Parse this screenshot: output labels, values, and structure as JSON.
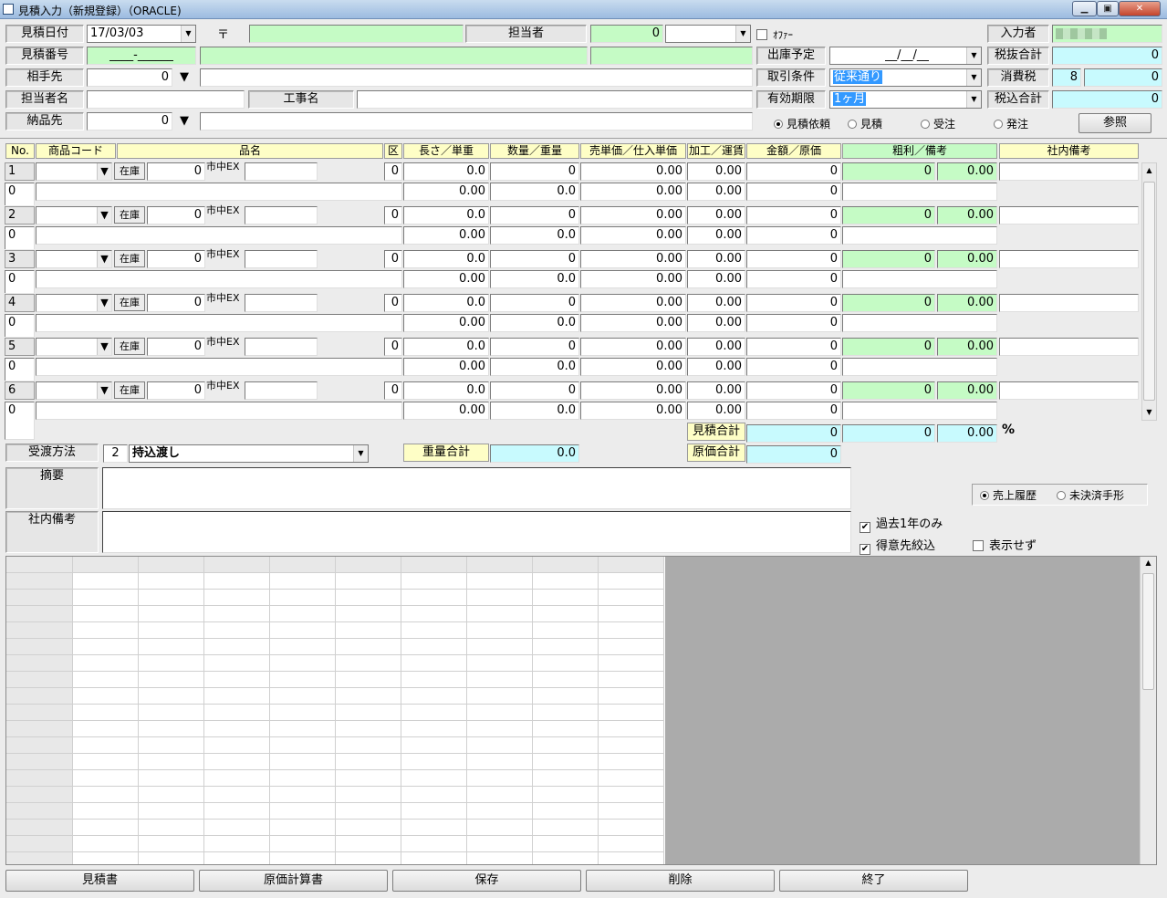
{
  "window": {
    "title": "見積入力（新規登録）（ORACLE)",
    "min": "▁",
    "max": "▣",
    "close": "✕"
  },
  "header": {
    "date_label": "見積日付",
    "date_value": "17/03/03",
    "postal_mark": "〒",
    "postal_value": "",
    "tanto_label": "担当者",
    "tanto_code": "0",
    "tanto_name": "",
    "offer_label": "ｵﾌｧｰ",
    "nyuryoku_label": "入力者",
    "mitsumori_no_label": "見積番号",
    "mitsumori_no_value": "____-______",
    "aite_label": "相手先",
    "aite_code": "0",
    "tantoname_label": "担当者名",
    "koji_label": "工事名",
    "nohin_label": "納品先",
    "nohin_code": "0",
    "shukko_label": "出庫予定",
    "shukko_value": "__/__/__",
    "torihiki_label": "取引条件",
    "torihiki_value": "従来通り",
    "yuko_label": "有効期限",
    "yuko_value": "1ヶ月",
    "zeinuki_label": "税抜合計",
    "zeinuki_value": "0",
    "shohizei_label": "消費税",
    "shohizei_rate": "8",
    "shohizei_value": "0",
    "zeikomi_label": "税込合計",
    "zeikomi_value": "0",
    "type_radios": [
      {
        "label": "見積依頼",
        "checked": true
      },
      {
        "label": "見積",
        "checked": false
      },
      {
        "label": "受注",
        "checked": false
      },
      {
        "label": "発注",
        "checked": false
      }
    ],
    "sansho_button": "参照"
  },
  "columns": {
    "no": "No.",
    "code": "商品コード",
    "name": "品名",
    "ku": "区",
    "length": "長さ／単重",
    "qty": "数量／重量",
    "price": "売単価／仕入単価",
    "kako": "加工／運賃",
    "amount": "金額／原価",
    "arari": "粗利／備考",
    "bikou": "社内備考"
  },
  "rows": [
    {
      "no": "1",
      "sub": "0",
      "qty": "0",
      "ku": "0",
      "len": "0.0",
      "num": "0",
      "price": "0.00",
      "kako": "0.00",
      "amount": "0",
      "arari": "0",
      "rate": "0.00",
      "wt": "0.00",
      "wq": "0.0",
      "cost": "0.00",
      "freight": "0.00",
      "genka": "0"
    },
    {
      "no": "2",
      "sub": "0",
      "qty": "0",
      "ku": "0",
      "len": "0.0",
      "num": "0",
      "price": "0.00",
      "kako": "0.00",
      "amount": "0",
      "arari": "0",
      "rate": "0.00",
      "wt": "0.00",
      "wq": "0.0",
      "cost": "0.00",
      "freight": "0.00",
      "genka": "0"
    },
    {
      "no": "3",
      "sub": "0",
      "qty": "0",
      "ku": "0",
      "len": "0.0",
      "num": "0",
      "price": "0.00",
      "kako": "0.00",
      "amount": "0",
      "arari": "0",
      "rate": "0.00",
      "wt": "0.00",
      "wq": "0.0",
      "cost": "0.00",
      "freight": "0.00",
      "genka": "0"
    },
    {
      "no": "4",
      "sub": "0",
      "qty": "0",
      "ku": "0",
      "len": "0.0",
      "num": "0",
      "price": "0.00",
      "kako": "0.00",
      "amount": "0",
      "arari": "0",
      "rate": "0.00",
      "wt": "0.00",
      "wq": "0.0",
      "cost": "0.00",
      "freight": "0.00",
      "genka": "0"
    },
    {
      "no": "5",
      "sub": "0",
      "qty": "0",
      "ku": "0",
      "len": "0.0",
      "num": "0",
      "price": "0.00",
      "kako": "0.00",
      "amount": "0",
      "arari": "0",
      "rate": "0.00",
      "wt": "0.00",
      "wq": "0.0",
      "cost": "0.00",
      "freight": "0.00",
      "genka": "0"
    },
    {
      "no": "6",
      "sub": "0",
      "qty": "0",
      "ku": "0",
      "len": "0.0",
      "num": "0",
      "price": "0.00",
      "kako": "0.00",
      "amount": "0",
      "arari": "0",
      "rate": "0.00",
      "wt": "0.00",
      "wq": "0.0",
      "cost": "0.00",
      "freight": "0.00",
      "genka": "0"
    }
  ],
  "row_labels": {
    "zaiko": "在庫",
    "market": "市中EX"
  },
  "totals": {
    "mitsumori_label": "見積合計",
    "mitsumori_amount": "0",
    "mitsumori_arari": "0",
    "mitsumori_rate": "0.00",
    "percent": "%",
    "genka_label": "原価合計",
    "genka_amount": "0",
    "juryo_label": "重量合計",
    "juryo_value": "0.0"
  },
  "juto": {
    "label": "受渡方法",
    "code": "2",
    "value": "持込渡し"
  },
  "tekiyo_label": "摘要",
  "shanai_label": "社内備考",
  "history": {
    "radios": [
      {
        "label": "売上履歴",
        "checked": true
      },
      {
        "label": "未決済手形",
        "checked": false
      }
    ],
    "checks": [
      {
        "label": "過去1年のみ",
        "checked": true
      },
      {
        "label": "得意先絞込",
        "checked": true
      },
      {
        "label": "表示せず",
        "checked": false
      }
    ]
  },
  "buttons": [
    "見積書",
    "原価計算書",
    "保存",
    "削除",
    "終了"
  ]
}
